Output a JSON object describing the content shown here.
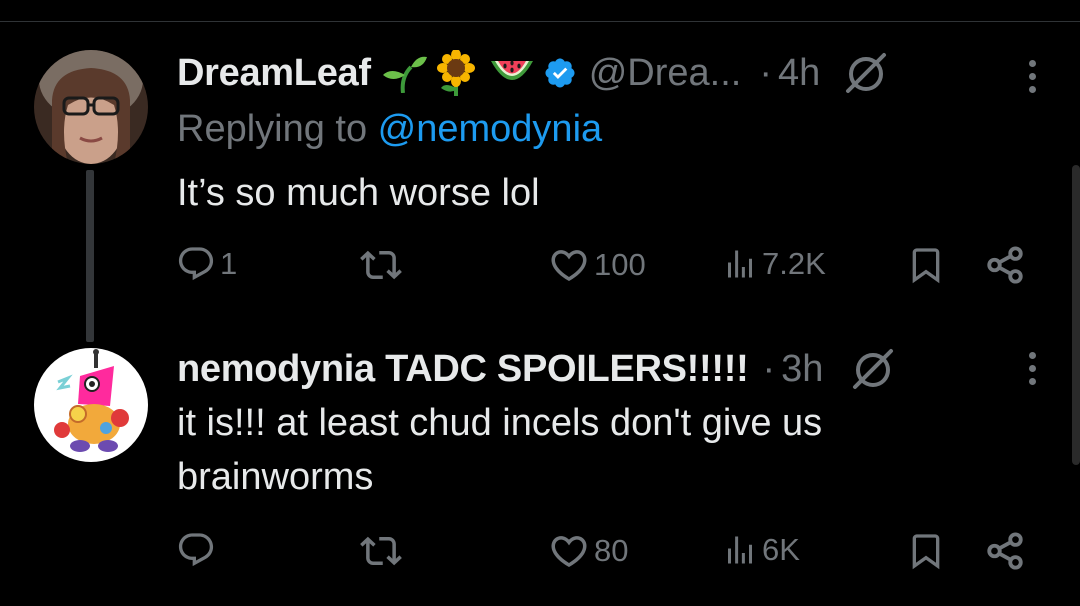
{
  "tweets": [
    {
      "display_name": "DreamLeaf",
      "emojis": [
        "seedling-icon",
        "sunflower-icon",
        "watermelon-icon"
      ],
      "verified": true,
      "handle": "@Drea...",
      "dot": "·",
      "time": "4h",
      "replying_prefix": "Replying to ",
      "replying_to": "@nemodynia",
      "text": "It’s so much worse lol",
      "replies": "1",
      "reposts": "",
      "likes": "100",
      "views": "7.2K"
    },
    {
      "display_name": "nemodynia TADC SPOILERS!!!!!",
      "dot": "·",
      "time": "3h",
      "text": "it is!!! at least chud incels don't give us brainworms",
      "replies": "",
      "reposts": "",
      "likes": "80",
      "views": "6K"
    }
  ],
  "colors": {
    "background": "#000000",
    "text": "#e7e9ea",
    "muted": "#71767b",
    "link": "#1d9bf0",
    "verified": "#1d9bf0"
  }
}
